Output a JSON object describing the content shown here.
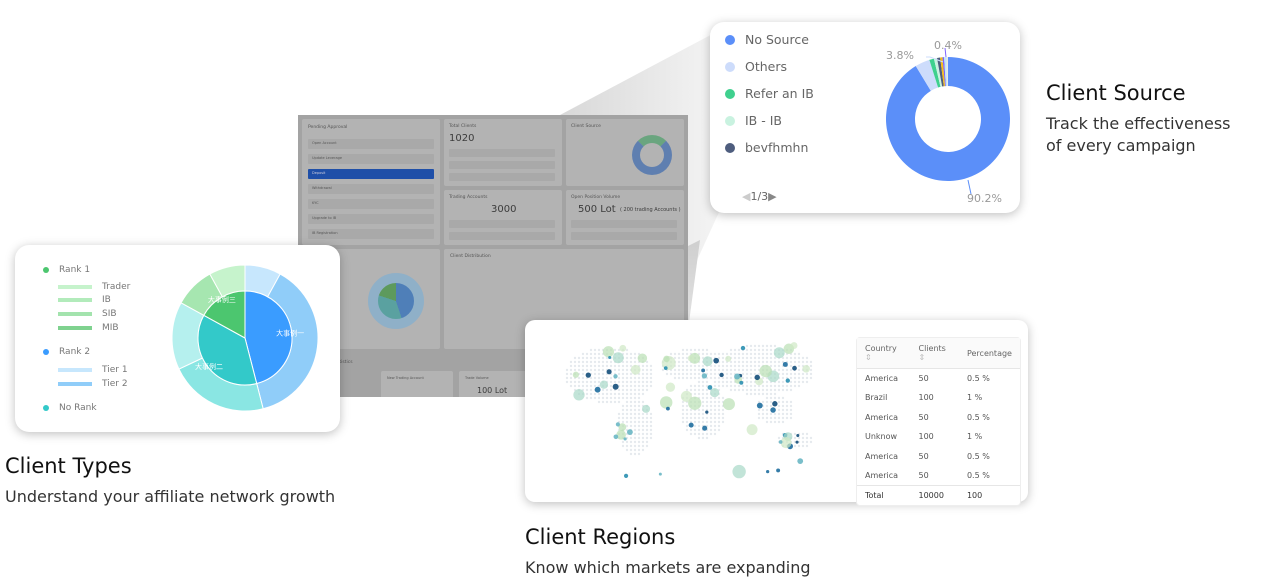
{
  "dashboard": {
    "pending_title": "Pending Approval",
    "pending_items": [
      "Open Account",
      "Update Leverage",
      "Deposit",
      "Withdrawal",
      "KYC",
      "Upgrade to IB",
      "IB Registration"
    ],
    "total_clients_title": "Total Clients",
    "total_clients_value": "1020",
    "client_source_title": "Client Source",
    "trading_accounts_title": "Trading Accounts",
    "trading_accounts_value": "3000",
    "open_position_title": "Open Position Volume",
    "open_position_value": "500 Lot",
    "open_position_note": "( 200 trading Accounts )",
    "client_distribution_title": "Client Distribution",
    "statistics_title": "Statistics",
    "new_trading_account_title": "New Trading Account",
    "trade_volume_title": "Trade Volume",
    "trade_volume_value": "100 Lot"
  },
  "client_types_card": {
    "legend": [
      {
        "label": "Rank 1",
        "color": "#4cc66f",
        "kind": "dot"
      },
      {
        "label": "Trader",
        "color": "#c6f3cc",
        "kind": "bar"
      },
      {
        "label": "IB",
        "color": "#b2ebbb",
        "kind": "bar"
      },
      {
        "label": "SIB",
        "color": "#a3e3ad",
        "kind": "bar"
      },
      {
        "label": "MIB",
        "color": "#7fd28f",
        "kind": "bar"
      },
      {
        "label": "Rank 2",
        "color": "#3a9cff",
        "kind": "dot"
      },
      {
        "label": "Tier 1",
        "color": "#c7e7fd",
        "kind": "bar"
      },
      {
        "label": "Tier 2",
        "color": "#90cdf9",
        "kind": "bar"
      },
      {
        "label": "No Rank",
        "color": "#33c9c9",
        "kind": "dot"
      }
    ],
    "inner": [
      {
        "label": "大事例一",
        "value": 46,
        "color": "#3a9cff"
      },
      {
        "label": "大事例二",
        "value": 37,
        "color": "#33c9c9"
      },
      {
        "label": "大事例三",
        "value": 17,
        "color": "#4cc66f"
      }
    ],
    "outer": [
      {
        "value": 8,
        "color": "#c7e7fd"
      },
      {
        "value": 38,
        "color": "#90cdf9"
      },
      {
        "value": 22,
        "color": "#8ae6e3"
      },
      {
        "value": 15,
        "color": "#b5f0ee"
      },
      {
        "value": 9,
        "color": "#a6e6b0"
      },
      {
        "value": 8,
        "color": "#c6f3cc"
      }
    ]
  },
  "client_source_card": {
    "legend": [
      {
        "label": "No Source",
        "color": "#5b8ff9"
      },
      {
        "label": "Others",
        "color": "#cddcfb"
      },
      {
        "label": "Refer an IB",
        "color": "#3fd08e"
      },
      {
        "label": "IB - IB",
        "color": "#c9f2e0"
      },
      {
        "label": "bevfhmhn",
        "color": "#4e5d7e"
      }
    ],
    "pager": "1/3",
    "slices": [
      {
        "value": 90.2,
        "color": "#5b8ff9"
      },
      {
        "value": 3.8,
        "color": "#cddcfb"
      },
      {
        "value": 1.2,
        "color": "#3fd08e"
      },
      {
        "value": 0.8,
        "color": "#c9f2e0"
      },
      {
        "value": 0.8,
        "color": "#4e5d7e"
      },
      {
        "value": 0.6,
        "color": "#f6bd16"
      },
      {
        "value": 0.4,
        "color": "#7b61ff"
      },
      {
        "value": 0.6,
        "color": "#bfe6f5"
      },
      {
        "value": 0.4,
        "color": "#e8e8e8"
      }
    ],
    "labels": {
      "a": "3.8%",
      "b": "0.4%",
      "c": "90.2%"
    }
  },
  "regions_table": {
    "headers": [
      "Country",
      "Clients",
      "Percentage"
    ],
    "rows": [
      [
        "America",
        "50",
        "0.5 %"
      ],
      [
        "Brazil",
        "100",
        "1 %"
      ],
      [
        "America",
        "50",
        "0.5 %"
      ],
      [
        "Unknow",
        "100",
        "1 %"
      ],
      [
        "America",
        "50",
        "0.5 %"
      ],
      [
        "America",
        "50",
        "0.5 %"
      ]
    ],
    "total": [
      "Total",
      "10000",
      "100"
    ]
  },
  "captions": {
    "types_title": "Client Types",
    "types_sub": "Understand your affiliate network growth",
    "source_title": "Client Source",
    "source_sub1": "Track the effectiveness",
    "source_sub2": "of every campaign",
    "regions_title": "Client Regions",
    "regions_sub": "Know which markets are expanding"
  }
}
